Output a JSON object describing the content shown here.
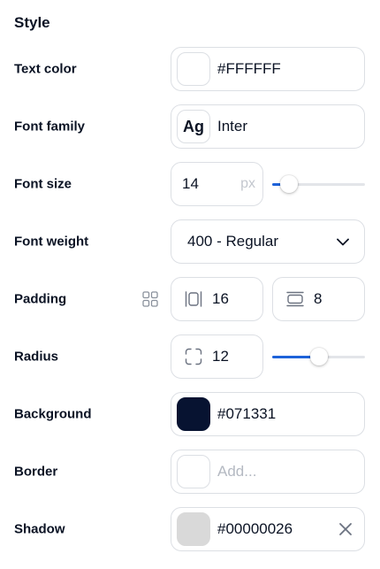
{
  "section": {
    "title": "Style"
  },
  "text_color": {
    "label": "Text color",
    "value": "#FFFFFF",
    "swatch": "#FFFFFF"
  },
  "font_family": {
    "label": "Font family",
    "preview": "Ag",
    "value": "Inter"
  },
  "font_size": {
    "label": "Font size",
    "value": "14",
    "unit": "px",
    "slider_fraction": 0.18
  },
  "font_weight": {
    "label": "Font weight",
    "value": "400 - Regular"
  },
  "padding": {
    "label": "Padding",
    "horizontal": "16",
    "vertical": "8"
  },
  "radius": {
    "label": "Radius",
    "value": "12",
    "slider_fraction": 0.5
  },
  "background": {
    "label": "Background",
    "value": "#071331",
    "swatch": "#071331"
  },
  "border": {
    "label": "Border",
    "placeholder": "Add..."
  },
  "shadow": {
    "label": "Shadow",
    "value": "#00000026",
    "swatch": "#D9D9D9"
  },
  "colors": {
    "accent": "#1D62D9",
    "field_border": "#DCDFE4"
  }
}
